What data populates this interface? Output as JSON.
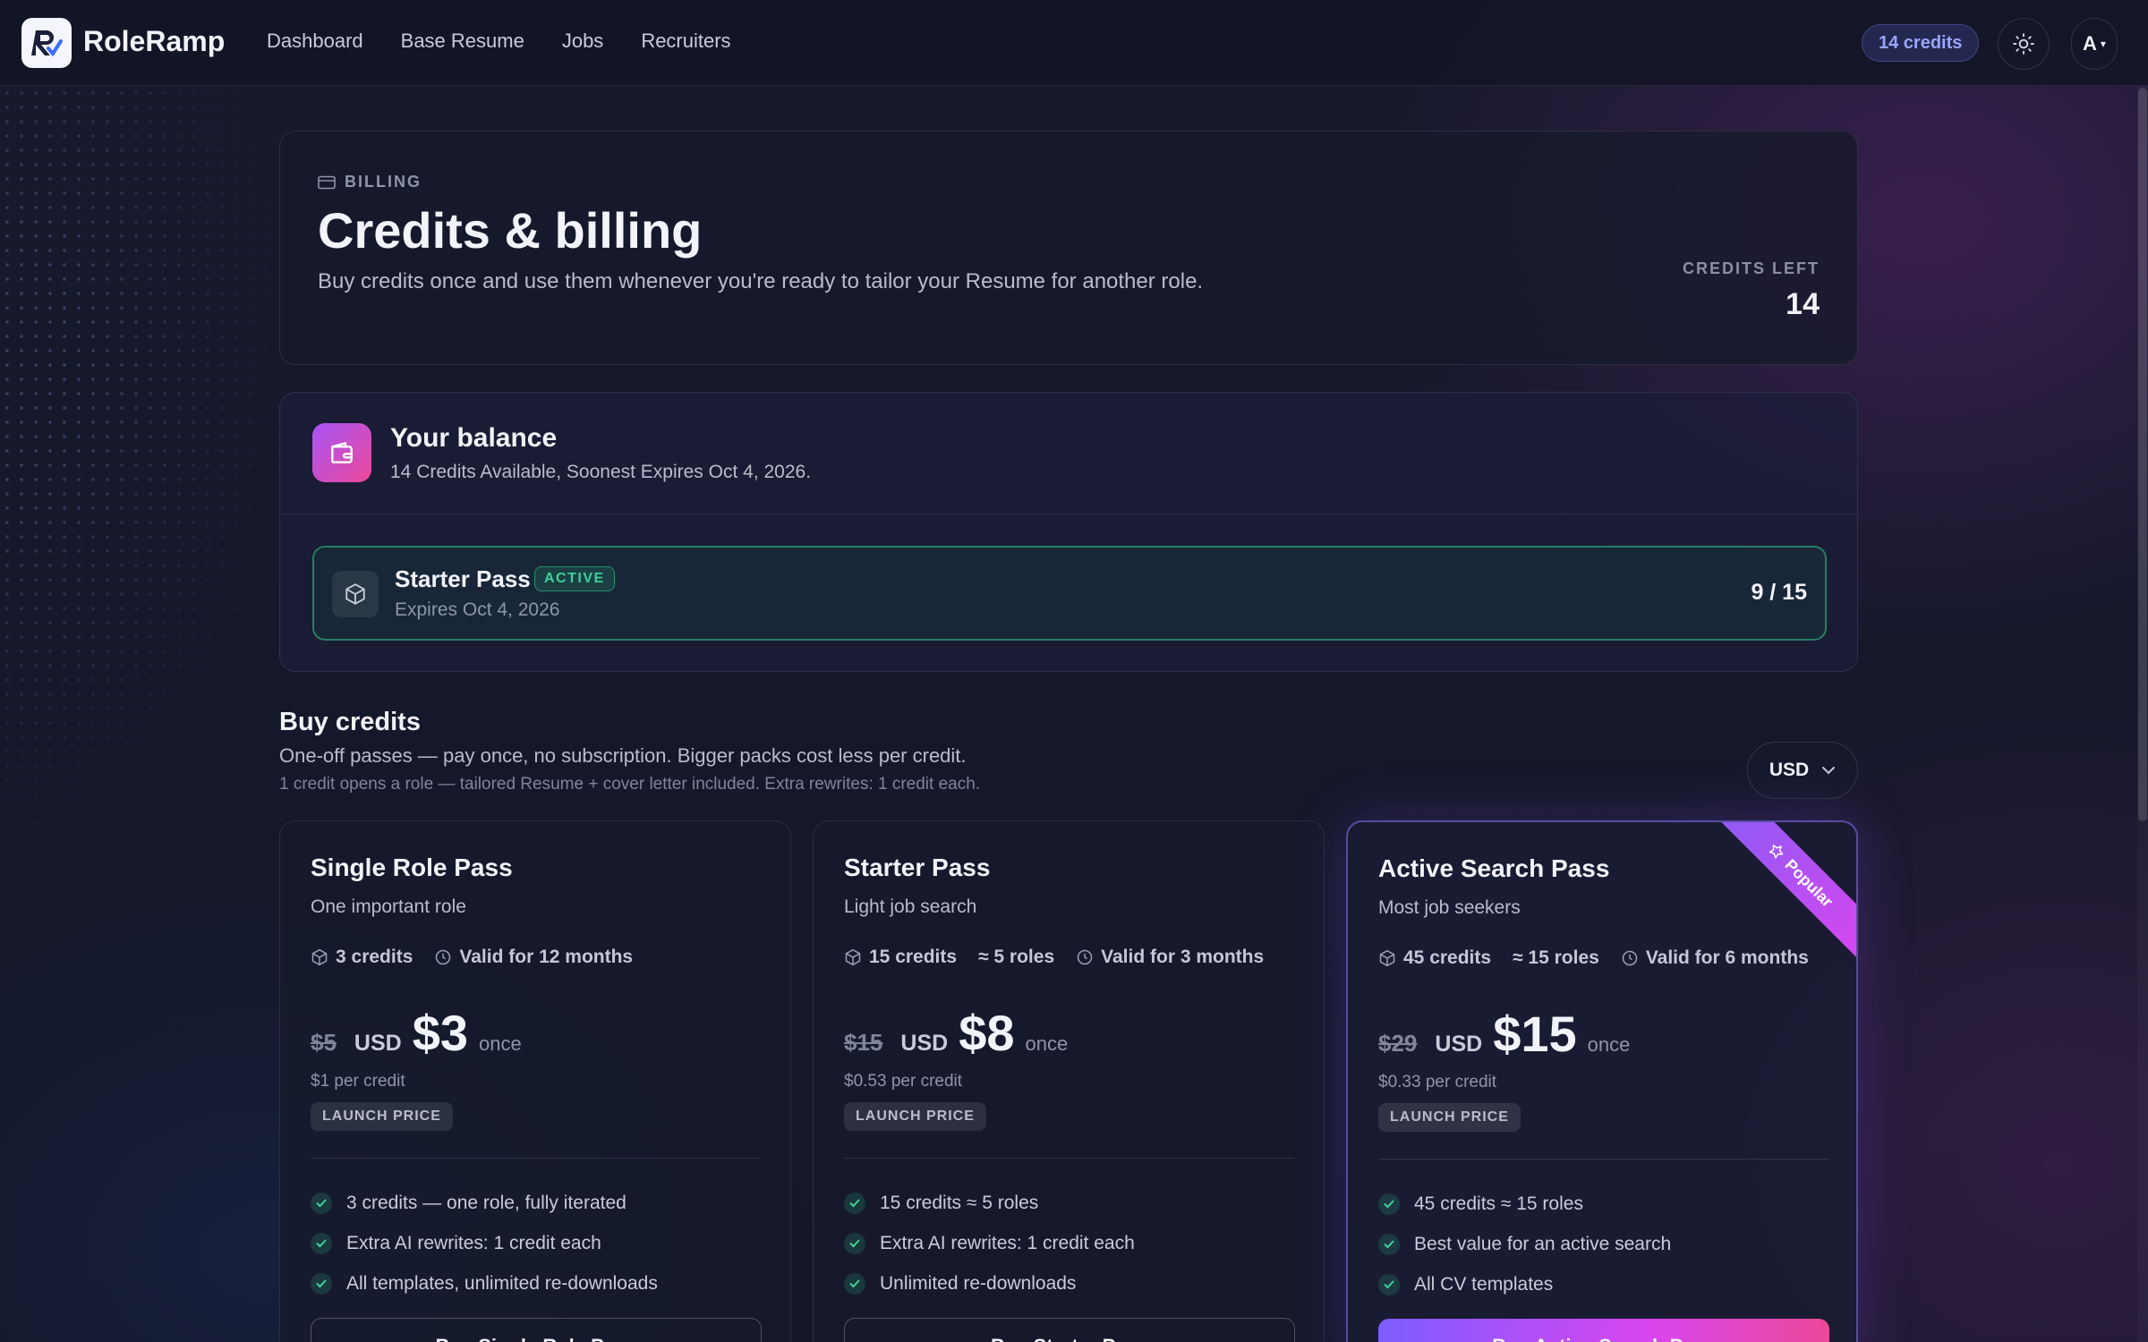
{
  "nav": {
    "brand": "RoleRamp",
    "links": [
      "Dashboard",
      "Base Resume",
      "Jobs",
      "Recruiters"
    ],
    "credits_pill": "14 credits",
    "avatar_initial": "A"
  },
  "hero": {
    "eyebrow": "BILLING",
    "title": "Credits & billing",
    "subtitle": "Buy credits once and use them whenever you're ready to tailor your Resume for another role.",
    "credits_left_label": "CREDITS LEFT",
    "credits_left_value": "14"
  },
  "balance": {
    "title": "Your balance",
    "subtitle": "14 Credits Available, Soonest Expires Oct 4, 2026.",
    "pass": {
      "name": "Starter Pass",
      "status": "ACTIVE",
      "expires": "Expires Oct 4, 2026",
      "usage": "9 / 15",
      "used_fraction": 0.6
    }
  },
  "buy": {
    "title": "Buy credits",
    "subtitle": "One-off passes — pay once, no subscription. Bigger packs cost less per credit.",
    "note": "1 credit opens a role — tailored Resume + cover letter included. Extra rewrites: 1 credit each.",
    "currency": "USD"
  },
  "plans": [
    {
      "name": "Single Role Pass",
      "tagline": "One important role",
      "credits": "3 credits",
      "roles": "",
      "validity": "Valid for 12 months",
      "old_price": "$5",
      "currency": "USD",
      "price": "$3",
      "period": "once",
      "per_credit": "$1 per credit",
      "badge": "LAUNCH PRICE",
      "features": [
        "3 credits — one role, fully iterated",
        "Extra AI rewrites: 1 credit each",
        "All templates, unlimited re-downloads"
      ],
      "button": "Buy Single Role Pass"
    },
    {
      "name": "Starter Pass",
      "tagline": "Light job search",
      "credits": "15 credits",
      "roles": "≈ 5 roles",
      "validity": "Valid for 3 months",
      "old_price": "$15",
      "currency": "USD",
      "price": "$8",
      "period": "once",
      "per_credit": "$0.53 per credit",
      "badge": "LAUNCH PRICE",
      "features": [
        "15 credits ≈ 5 roles",
        "Extra AI rewrites: 1 credit each",
        "Unlimited re-downloads"
      ],
      "button": "Buy Starter Pass"
    },
    {
      "name": "Active Search Pass",
      "tagline": "Most job seekers",
      "credits": "45 credits",
      "roles": "≈ 15 roles",
      "validity": "Valid for 6 months",
      "old_price": "$29",
      "currency": "USD",
      "price": "$15",
      "period": "once",
      "per_credit": "$0.33 per credit",
      "badge": "LAUNCH PRICE",
      "features": [
        "45 credits ≈ 15 roles",
        "Best value for an active search",
        "All CV templates"
      ],
      "button": "Buy Active Search Pass",
      "ribbon": "Popular"
    }
  ],
  "colors": {
    "accent": "#7c5cff",
    "active_green": "#3ed19a",
    "popular_gradient_end": "#ec4899"
  }
}
